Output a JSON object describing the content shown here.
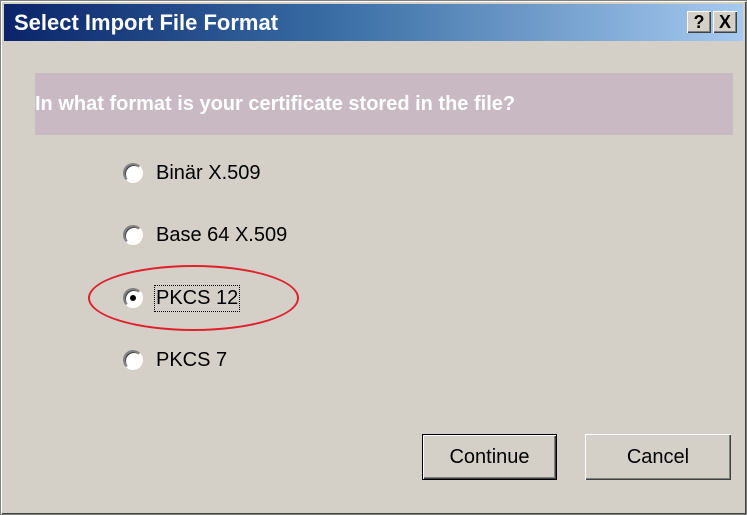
{
  "dialog": {
    "title": "Select Import File Format",
    "help_button": "?",
    "close_button": "X",
    "question": "In what format is your certificate stored in the file?"
  },
  "options": [
    {
      "label": "Binär X.509",
      "selected": false
    },
    {
      "label": "Base 64 X.509",
      "selected": false
    },
    {
      "label": "PKCS 12",
      "selected": true
    },
    {
      "label": "PKCS 7",
      "selected": false
    }
  ],
  "buttons": {
    "continue_label": "Continue",
    "cancel_label": "Cancel"
  },
  "colors": {
    "title_bar_start": "#0a246a",
    "title_bar_end": "#a6caf0",
    "dialog_background": "#d4d0c8",
    "question_banner": "#c9b9c3",
    "annotation_ellipse": "#e0202a"
  }
}
